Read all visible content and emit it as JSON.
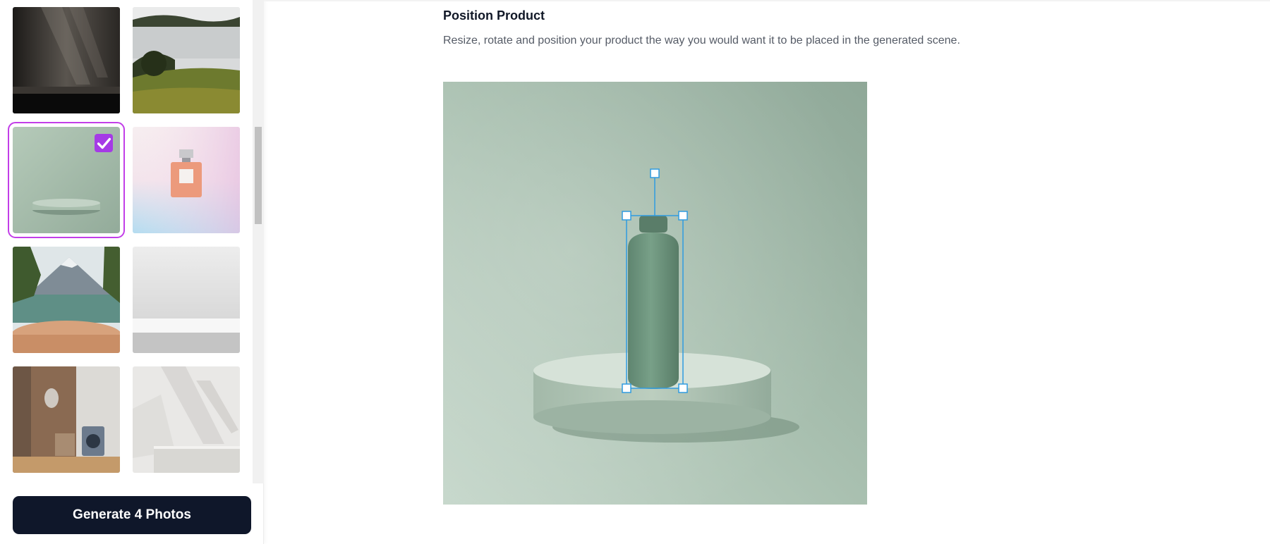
{
  "sidebar": {
    "thumbnails": [
      {
        "name": "dark-shadow-room",
        "selected": false
      },
      {
        "name": "foggy-hills",
        "selected": false
      },
      {
        "name": "sage-podium",
        "selected": true
      },
      {
        "name": "perfume-pastel",
        "selected": false
      },
      {
        "name": "mountain-lake-wood-table",
        "selected": false
      },
      {
        "name": "white-shelf",
        "selected": false
      },
      {
        "name": "bathroom-counter",
        "selected": false
      },
      {
        "name": "white-marble-shadows",
        "selected": false
      }
    ],
    "selected_check_icon": "check-icon",
    "generate_label": "Generate 4 Photos"
  },
  "main": {
    "title": "Position Product",
    "description": "Resize, rotate and position your product the way you would want it to be placed in the generated scene."
  },
  "colors": {
    "accent_purple": "#a53ae6",
    "selection_outline": "#c23ee8",
    "transform_handles": "#2f9be0",
    "button_bg": "#0f172a"
  }
}
